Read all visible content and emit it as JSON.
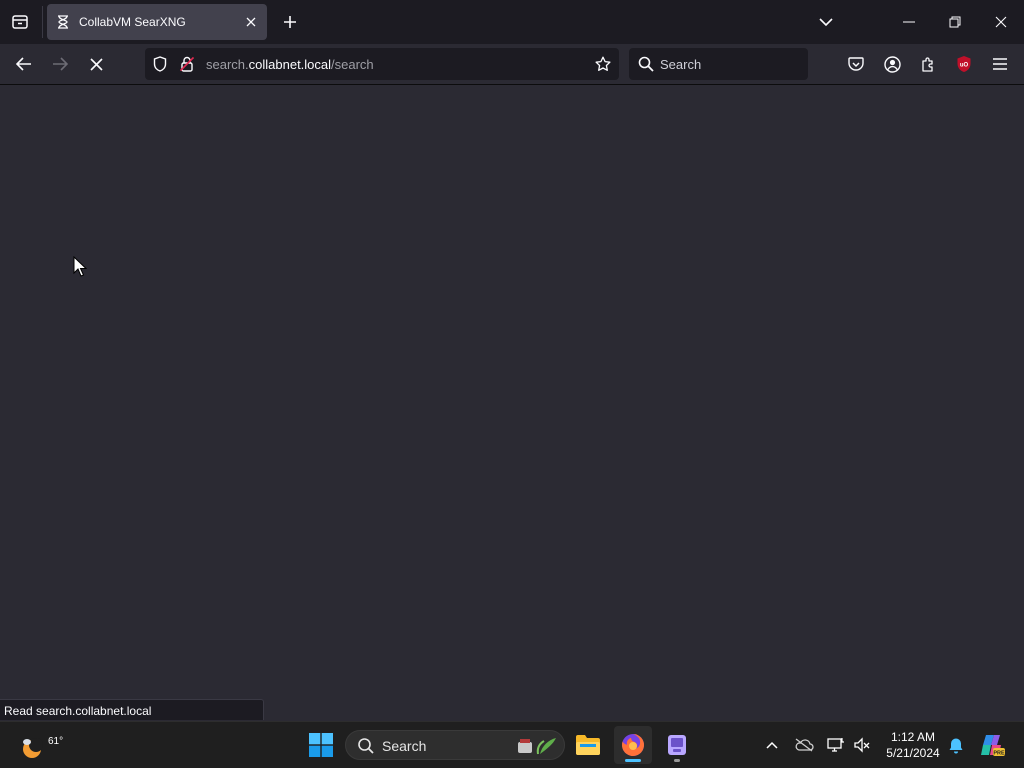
{
  "browser": {
    "tab": {
      "title": "CollabVM SearXNG"
    },
    "url": {
      "prefix": "search.",
      "host": "collabnet.local",
      "path": "/search"
    },
    "search_placeholder": "Search",
    "status_text": "Read search.collabnet.local"
  },
  "taskbar": {
    "weather_temp": "61°",
    "search_placeholder": "Search",
    "clock_time": "1:12 AM",
    "clock_date": "5/21/2024"
  },
  "colors": {
    "accent": "#0078d4",
    "firefox_indicator": "#4cc2ff",
    "ublock_red": "#c0102a"
  }
}
